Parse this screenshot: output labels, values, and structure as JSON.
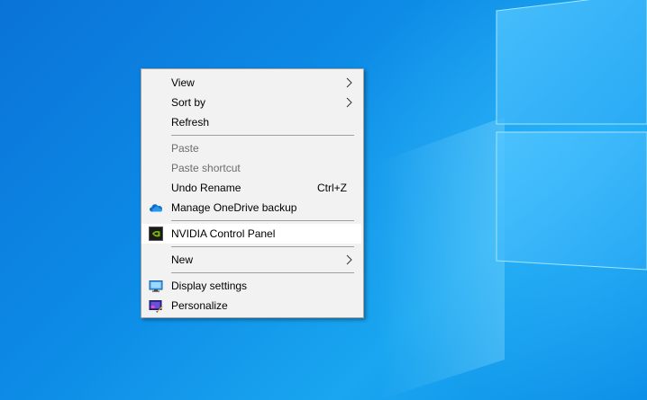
{
  "context_menu": {
    "items": [
      {
        "label": "View",
        "submenu": true
      },
      {
        "label": "Sort by",
        "submenu": true
      },
      {
        "label": "Refresh"
      },
      {
        "label": "Paste",
        "disabled": true
      },
      {
        "label": "Paste shortcut",
        "disabled": true
      },
      {
        "label": "Undo Rename",
        "shortcut": "Ctrl+Z"
      },
      {
        "label": "Manage OneDrive backup",
        "icon": "onedrive-cloud-icon"
      },
      {
        "label": "NVIDIA Control Panel",
        "icon": "nvidia-icon"
      },
      {
        "label": "New",
        "submenu": true
      },
      {
        "label": "Display settings",
        "icon": "display-settings-icon"
      },
      {
        "label": "Personalize",
        "icon": "personalize-icon"
      }
    ]
  },
  "colors": {
    "desktop_blue": "#0a73d8",
    "menu_bg": "#f2f2f2",
    "separator": "#a0a0a0",
    "disabled_text": "#6d6d6d"
  }
}
